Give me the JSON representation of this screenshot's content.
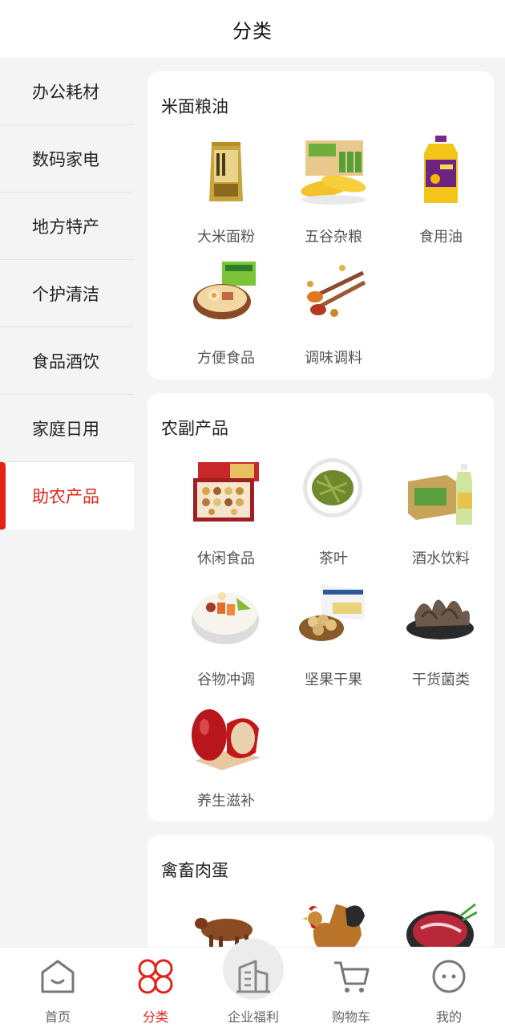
{
  "header": {
    "title": "分类"
  },
  "sidebar": {
    "items": [
      {
        "label": "办公耗材"
      },
      {
        "label": "数码家电"
      },
      {
        "label": "地方特产"
      },
      {
        "label": "个护清洁"
      },
      {
        "label": "食品酒饮"
      },
      {
        "label": "家庭日用"
      },
      {
        "label": "助农产品"
      }
    ],
    "active": "助农产品"
  },
  "sections": [
    {
      "title": "米面粮油",
      "products": [
        {
          "name": "大米面粉",
          "icon": "rice-flour-bag-icon"
        },
        {
          "name": "五谷杂粮",
          "icon": "corn-grains-icon"
        },
        {
          "name": "食用油",
          "icon": "cooking-oil-bottle-icon"
        },
        {
          "name": "方便食品",
          "icon": "instant-noodle-bowl-icon"
        },
        {
          "name": "调味调料",
          "icon": "spice-spoons-icon"
        }
      ]
    },
    {
      "title": "农副产品",
      "products": [
        {
          "name": "休闲食品",
          "icon": "snack-gift-box-icon"
        },
        {
          "name": "茶叶",
          "icon": "green-tea-plate-icon"
        },
        {
          "name": "酒水饮料",
          "icon": "drink-box-bottle-icon"
        },
        {
          "name": "谷物冲调",
          "icon": "cereal-bowl-icon"
        },
        {
          "name": "坚果干果",
          "icon": "nuts-bowl-icon"
        },
        {
          "name": "干货菌类",
          "icon": "dried-mushroom-icon"
        },
        {
          "name": "养生滋补",
          "icon": "red-dates-icon"
        }
      ]
    },
    {
      "title": "禽畜肉蛋",
      "products": [
        {
          "name": "",
          "icon": "cattle-icon"
        },
        {
          "name": "",
          "icon": "chicken-icon"
        },
        {
          "name": "",
          "icon": "raw-meat-icon"
        }
      ]
    }
  ],
  "tabbar": {
    "items": [
      {
        "label": "首页",
        "icon": "home-icon"
      },
      {
        "label": "分类",
        "icon": "category-icon"
      },
      {
        "label": "企业福利",
        "icon": "building-icon"
      },
      {
        "label": "购物车",
        "icon": "cart-icon"
      },
      {
        "label": "我的",
        "icon": "profile-face-icon"
      }
    ],
    "active": "分类"
  },
  "colors": {
    "accent": "#e2231a",
    "background": "#f4f4f4",
    "card": "#ffffff"
  }
}
